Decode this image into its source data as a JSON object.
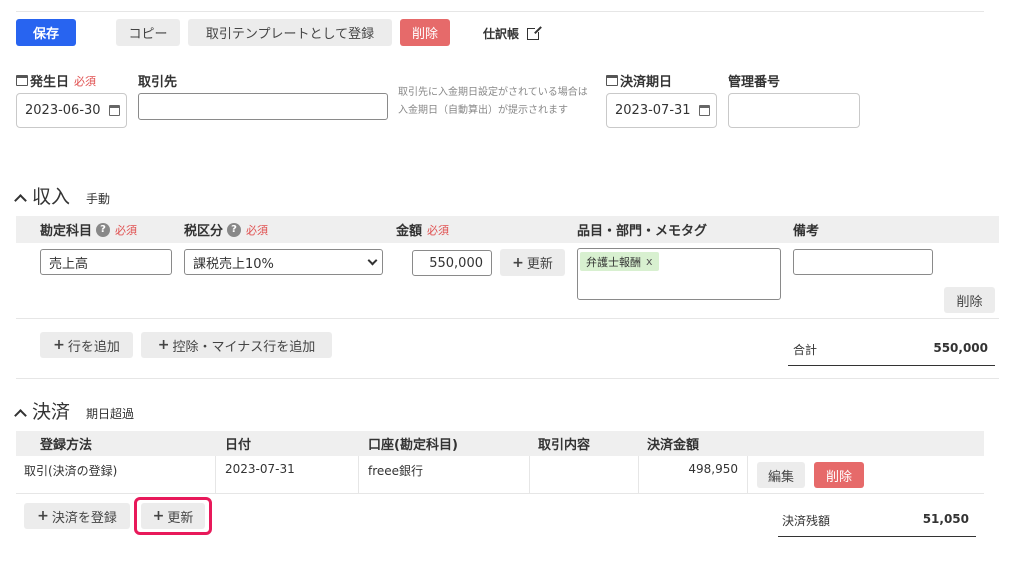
{
  "toolbar": {
    "save_label": "保存",
    "copy_label": "コピー",
    "template_label": "取引テンプレートとして登録",
    "delete_label": "削除",
    "journal_label": "仕訳帳"
  },
  "header": {
    "issue_date_label": "発生日",
    "required": "必須",
    "issue_date_value": "2023-06-30",
    "partner_label": "取引先",
    "partner_value": "",
    "partner_hint_1": "取引先に入金期日設定がされている場合は",
    "partner_hint_2": "入金期日（自動算出）が提示されます",
    "due_date_label": "決済期日",
    "due_date_value": "2023-07-31",
    "management_no_label": "管理番号",
    "management_no_value": ""
  },
  "income": {
    "title": "収入",
    "mode": "手動",
    "col_account": "勘定科目",
    "col_tax": "税区分",
    "col_amount": "金額",
    "col_tags": "品目・部門・メモタグ",
    "col_note": "備考",
    "row": {
      "account": "売上高",
      "tax": "課税売上10%",
      "amount": "550,000",
      "update_label": "更新",
      "tag": "弁護士報酬",
      "tag_remove": "x",
      "note": "",
      "delete_label": "削除"
    },
    "add_row_label": "行を追加",
    "add_minus_row_label": "控除・マイナス行を追加",
    "total_label": "合計",
    "total_value": "550,000"
  },
  "settlement": {
    "title": "決済",
    "status": "期日超過",
    "col_method": "登録方法",
    "col_date": "日付",
    "col_account": "口座(勘定科目)",
    "col_content": "取引内容",
    "col_amount": "決済金額",
    "row": {
      "method": "取引(決済の登録)",
      "date": "2023-07-31",
      "account": "freee銀行",
      "content": "",
      "amount": "498,950",
      "edit_label": "編集",
      "delete_label": "削除"
    },
    "register_label": "決済を登録",
    "update_label": "更新",
    "balance_label": "決済残額",
    "balance_value": "51,050"
  },
  "colors": {
    "primary": "#2864f0",
    "danger": "#e66a6a",
    "required": "#e04f4f",
    "highlight": "#e8195a",
    "tag_bg": "#d8f0d0"
  }
}
